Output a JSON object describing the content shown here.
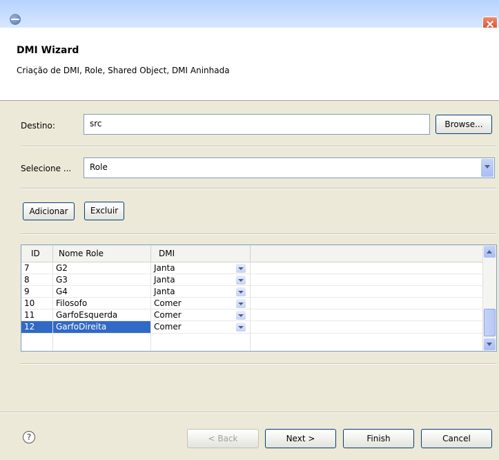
{
  "window": {
    "title": "DMI Wizard",
    "subtitle": "Criação de DMI, Role, Shared Object, DMI Aninhada"
  },
  "form": {
    "destino_label": "Destino:",
    "destino_value": "src",
    "browse_label": "Browse...",
    "selecione_label": "Selecione ...",
    "selecione_value": "Role",
    "adicionar_label": "Adicionar",
    "excluir_label": "Excluir"
  },
  "table": {
    "headers": [
      "ID",
      "Nome Role",
      "DMI"
    ],
    "rows": [
      {
        "id": "7",
        "nome": "G2",
        "dmi": "Janta"
      },
      {
        "id": "8",
        "nome": "G3",
        "dmi": "Janta"
      },
      {
        "id": "9",
        "nome": "G4",
        "dmi": "Janta"
      },
      {
        "id": "10",
        "nome": "Filosofo",
        "dmi": "Comer"
      },
      {
        "id": "11",
        "nome": "GarfoEsquerda",
        "dmi": "Comer"
      },
      {
        "id": "12",
        "nome": "GarfoDireita",
        "dmi": "Comer"
      }
    ]
  },
  "footer": {
    "help_icon": "?",
    "back_label": "< Back",
    "next_label": "Next >",
    "finish_label": "Finish",
    "cancel_label": "Cancel"
  },
  "icons": [
    "app-icon",
    "close-icon",
    "help-icon",
    "chevron-down-icon",
    "scroll-up-icon",
    "scroll-down-icon"
  ],
  "colors": {
    "selection": "#316ac5",
    "close": "#d4452a"
  }
}
